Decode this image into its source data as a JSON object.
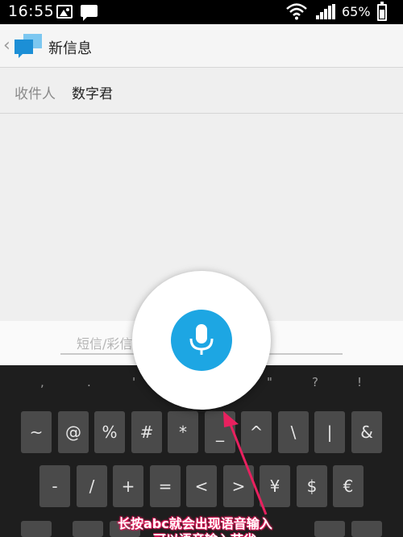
{
  "status_bar": {
    "time": "16:55",
    "battery_percent": "65%",
    "icons": [
      "image-icon",
      "chat-icon",
      "wifi-icon",
      "signal-icon",
      "battery-icon"
    ]
  },
  "action_bar": {
    "title": "新信息",
    "back_icon": "chevron-left-icon",
    "app_icon": "messages-icon"
  },
  "recipient": {
    "label": "收件人",
    "value": "数字君"
  },
  "compose": {
    "placeholder": "短信/彩信"
  },
  "keyboard": {
    "suggestion_row": [
      ",",
      ".",
      "'",
      "\"",
      "?",
      "!"
    ],
    "row1": [
      "~",
      "@",
      "%",
      "#",
      "*",
      "_",
      "^",
      "\\",
      "|",
      "&"
    ],
    "row2": [
      "-",
      "/",
      "+",
      "=",
      "<",
      ">",
      "¥",
      "$",
      "€"
    ],
    "row3": [
      "",
      "",
      "",
      "",
      "",
      "",
      "",
      "",
      "",
      ""
    ]
  },
  "voice_input": {
    "icon": "microphone-icon",
    "accent_color": "#1da6e3"
  },
  "annotation": {
    "line1": "长按abc就会出现语音输入",
    "line2": "可以语音输入节省",
    "color": "#e8215f"
  }
}
